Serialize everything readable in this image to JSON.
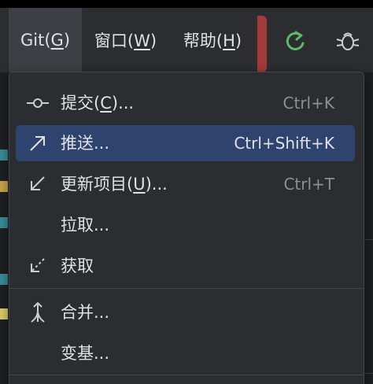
{
  "menubar": {
    "items": [
      {
        "pre": "Git(",
        "key": "G",
        "post": ")",
        "active": true
      },
      {
        "pre": "窗口(",
        "key": "W",
        "post": ")",
        "active": false
      },
      {
        "pre": "帮助(",
        "key": "H",
        "post": ")",
        "active": false
      }
    ],
    "toolbar_icons": [
      "update-project-icon",
      "debug-icon"
    ]
  },
  "git_menu": {
    "items": [
      {
        "icon": "commit-icon",
        "pre": "提交(",
        "key": "C",
        "post": ")...",
        "shortcut": "Ctrl+K",
        "selected": false
      },
      {
        "icon": "push-icon",
        "pre": "推送...",
        "key": "",
        "post": "",
        "shortcut": "Ctrl+Shift+K",
        "selected": true
      },
      {
        "icon": "update-icon",
        "pre": "更新项目(",
        "key": "U",
        "post": ")...",
        "shortcut": "Ctrl+T",
        "selected": false
      },
      {
        "icon": "",
        "pre": "拉取...",
        "key": "",
        "post": "",
        "shortcut": "",
        "selected": false
      },
      {
        "icon": "fetch-icon",
        "pre": "获取",
        "key": "",
        "post": "",
        "shortcut": "",
        "selected": false
      },
      {
        "icon": "merge-icon",
        "pre": "合并...",
        "key": "",
        "post": "",
        "shortcut": "",
        "selected": false
      },
      {
        "icon": "",
        "pre": "变基...",
        "key": "",
        "post": "",
        "shortcut": "",
        "selected": false
      }
    ]
  },
  "colors": {
    "menubar_bg": "#2b2d30",
    "menu_bg": "#2b2d30",
    "selection_bg": "#2e436e",
    "text": "#dfe1e5",
    "shortcut_text": "#8c8f96",
    "update_icon_green": "#5fb865",
    "stop_red": "#a33a3a"
  }
}
